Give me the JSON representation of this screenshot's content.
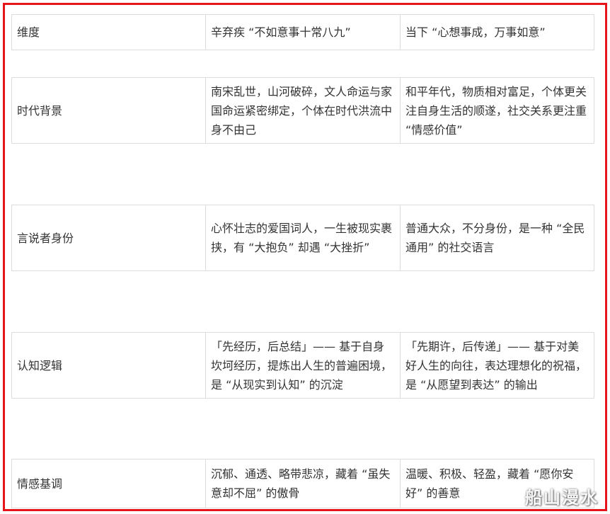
{
  "table": {
    "header": {
      "dimension": "维度",
      "xin": "辛弃疾 “不如意事十常八九”",
      "now": "当下 “心想事成，万事如意”"
    },
    "rows": [
      {
        "dimension": "时代背景",
        "xin": "南宋乱世，山河破碎，文人命运与家国命运紧密绑定，个体在时代洪流中身不由己",
        "now": "和平年代，物质相对富足，个体更关注自身生活的顺遂，社交关系更注重 “情感价值”"
      },
      {
        "dimension": "言说者身份",
        "xin": "心怀壮志的爱国词人，一生被现实裹挟，有 “大抱负” 却遇 “大挫折”",
        "now": "普通大众，不分身份，是一种 “全民通用” 的社交语言"
      },
      {
        "dimension": "认知逻辑",
        "xin": "「先经历，后总结」—— 基于自身坎坷经历，提炼出人生的普遍困境，是 “从现实到认知” 的沉淀",
        "now": "「先期许，后传递」—— 基于对美好人生的向往，表达理想化的祝福，是 “从愿望到表达” 的输出"
      },
      {
        "dimension": "情感基调",
        "xin": "沉郁、通透、略带悲凉，藏着 “虽失意却不屈” 的傲骨",
        "now": "温暖、积极、轻盈，藏着 “愿你安好” 的善意"
      }
    ]
  },
  "watermark": "船山漫水",
  "colors": {
    "frame": "#e8141b",
    "border": "#dcdcdc",
    "text": "#333333"
  }
}
